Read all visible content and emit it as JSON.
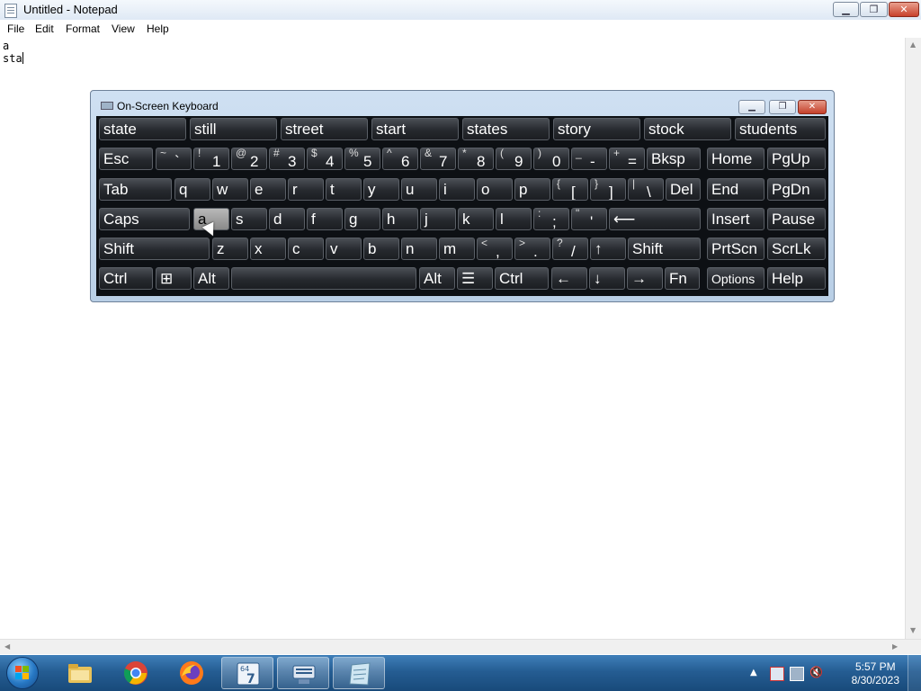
{
  "window": {
    "title": "Untitled - Notepad",
    "min": "▁",
    "max": "❐",
    "close": "✕"
  },
  "menu": {
    "items": [
      "File",
      "Edit",
      "Format",
      "View",
      "Help"
    ]
  },
  "editor": {
    "lines": [
      "a",
      "sta"
    ]
  },
  "osk": {
    "title": "On-Screen Keyboard",
    "suggestions": [
      "state",
      "still",
      "street",
      "start",
      "states",
      "story",
      "stock",
      "students"
    ],
    "row1": [
      {
        "label": "Esc"
      },
      {
        "sym": "~",
        "main": "`"
      },
      {
        "sym": "!",
        "main": "1"
      },
      {
        "sym": "@",
        "main": "2"
      },
      {
        "sym": "#",
        "main": "3"
      },
      {
        "sym": "$",
        "main": "4"
      },
      {
        "sym": "%",
        "main": "5"
      },
      {
        "sym": "^",
        "main": "6"
      },
      {
        "sym": "&",
        "main": "7"
      },
      {
        "sym": "*",
        "main": "8"
      },
      {
        "sym": "(",
        "main": "9"
      },
      {
        "sym": ")",
        "main": "0"
      },
      {
        "sym": "_",
        "main": "-"
      },
      {
        "sym": "+",
        "main": "="
      },
      {
        "label": "Bksp"
      }
    ],
    "row2": [
      "Tab",
      "q",
      "w",
      "e",
      "r",
      "t",
      "y",
      "u",
      "i",
      "o",
      "p",
      "[",
      "]",
      "\\",
      "Del"
    ],
    "row2_syms": [
      "",
      "",
      "",
      "",
      "",
      "",
      "",
      "",
      "",
      "",
      "",
      "{",
      "}",
      "|",
      ""
    ],
    "row3": [
      "Caps",
      "a",
      "s",
      "d",
      "f",
      "g",
      "h",
      "j",
      "k",
      "l",
      ";",
      "'",
      "⟵"
    ],
    "row3_syms": [
      "",
      "",
      "",
      "",
      "",
      "",
      "",
      "",
      "",
      "",
      ":",
      "\"",
      ""
    ],
    "row4": [
      "Shift",
      "z",
      "x",
      "c",
      "v",
      "b",
      "n",
      "m",
      ",",
      ".",
      "/",
      "↑",
      "Shift"
    ],
    "row4_syms": [
      "",
      "",
      "",
      "",
      "",
      "",
      "",
      "",
      "<",
      ">",
      "?",
      "",
      ""
    ],
    "row5": [
      "Ctrl",
      "⊞",
      "Alt",
      "",
      "Alt",
      "☰",
      "Ctrl",
      "←",
      "↓",
      "→",
      "Fn"
    ],
    "nav": [
      "Home",
      "PgUp",
      "End",
      "PgDn",
      "Insert",
      "Pause",
      "PrtScn",
      "ScrLk",
      "Options",
      "Help"
    ]
  },
  "taskbar": {
    "time": "5:57 PM",
    "date": "8/30/2023"
  }
}
